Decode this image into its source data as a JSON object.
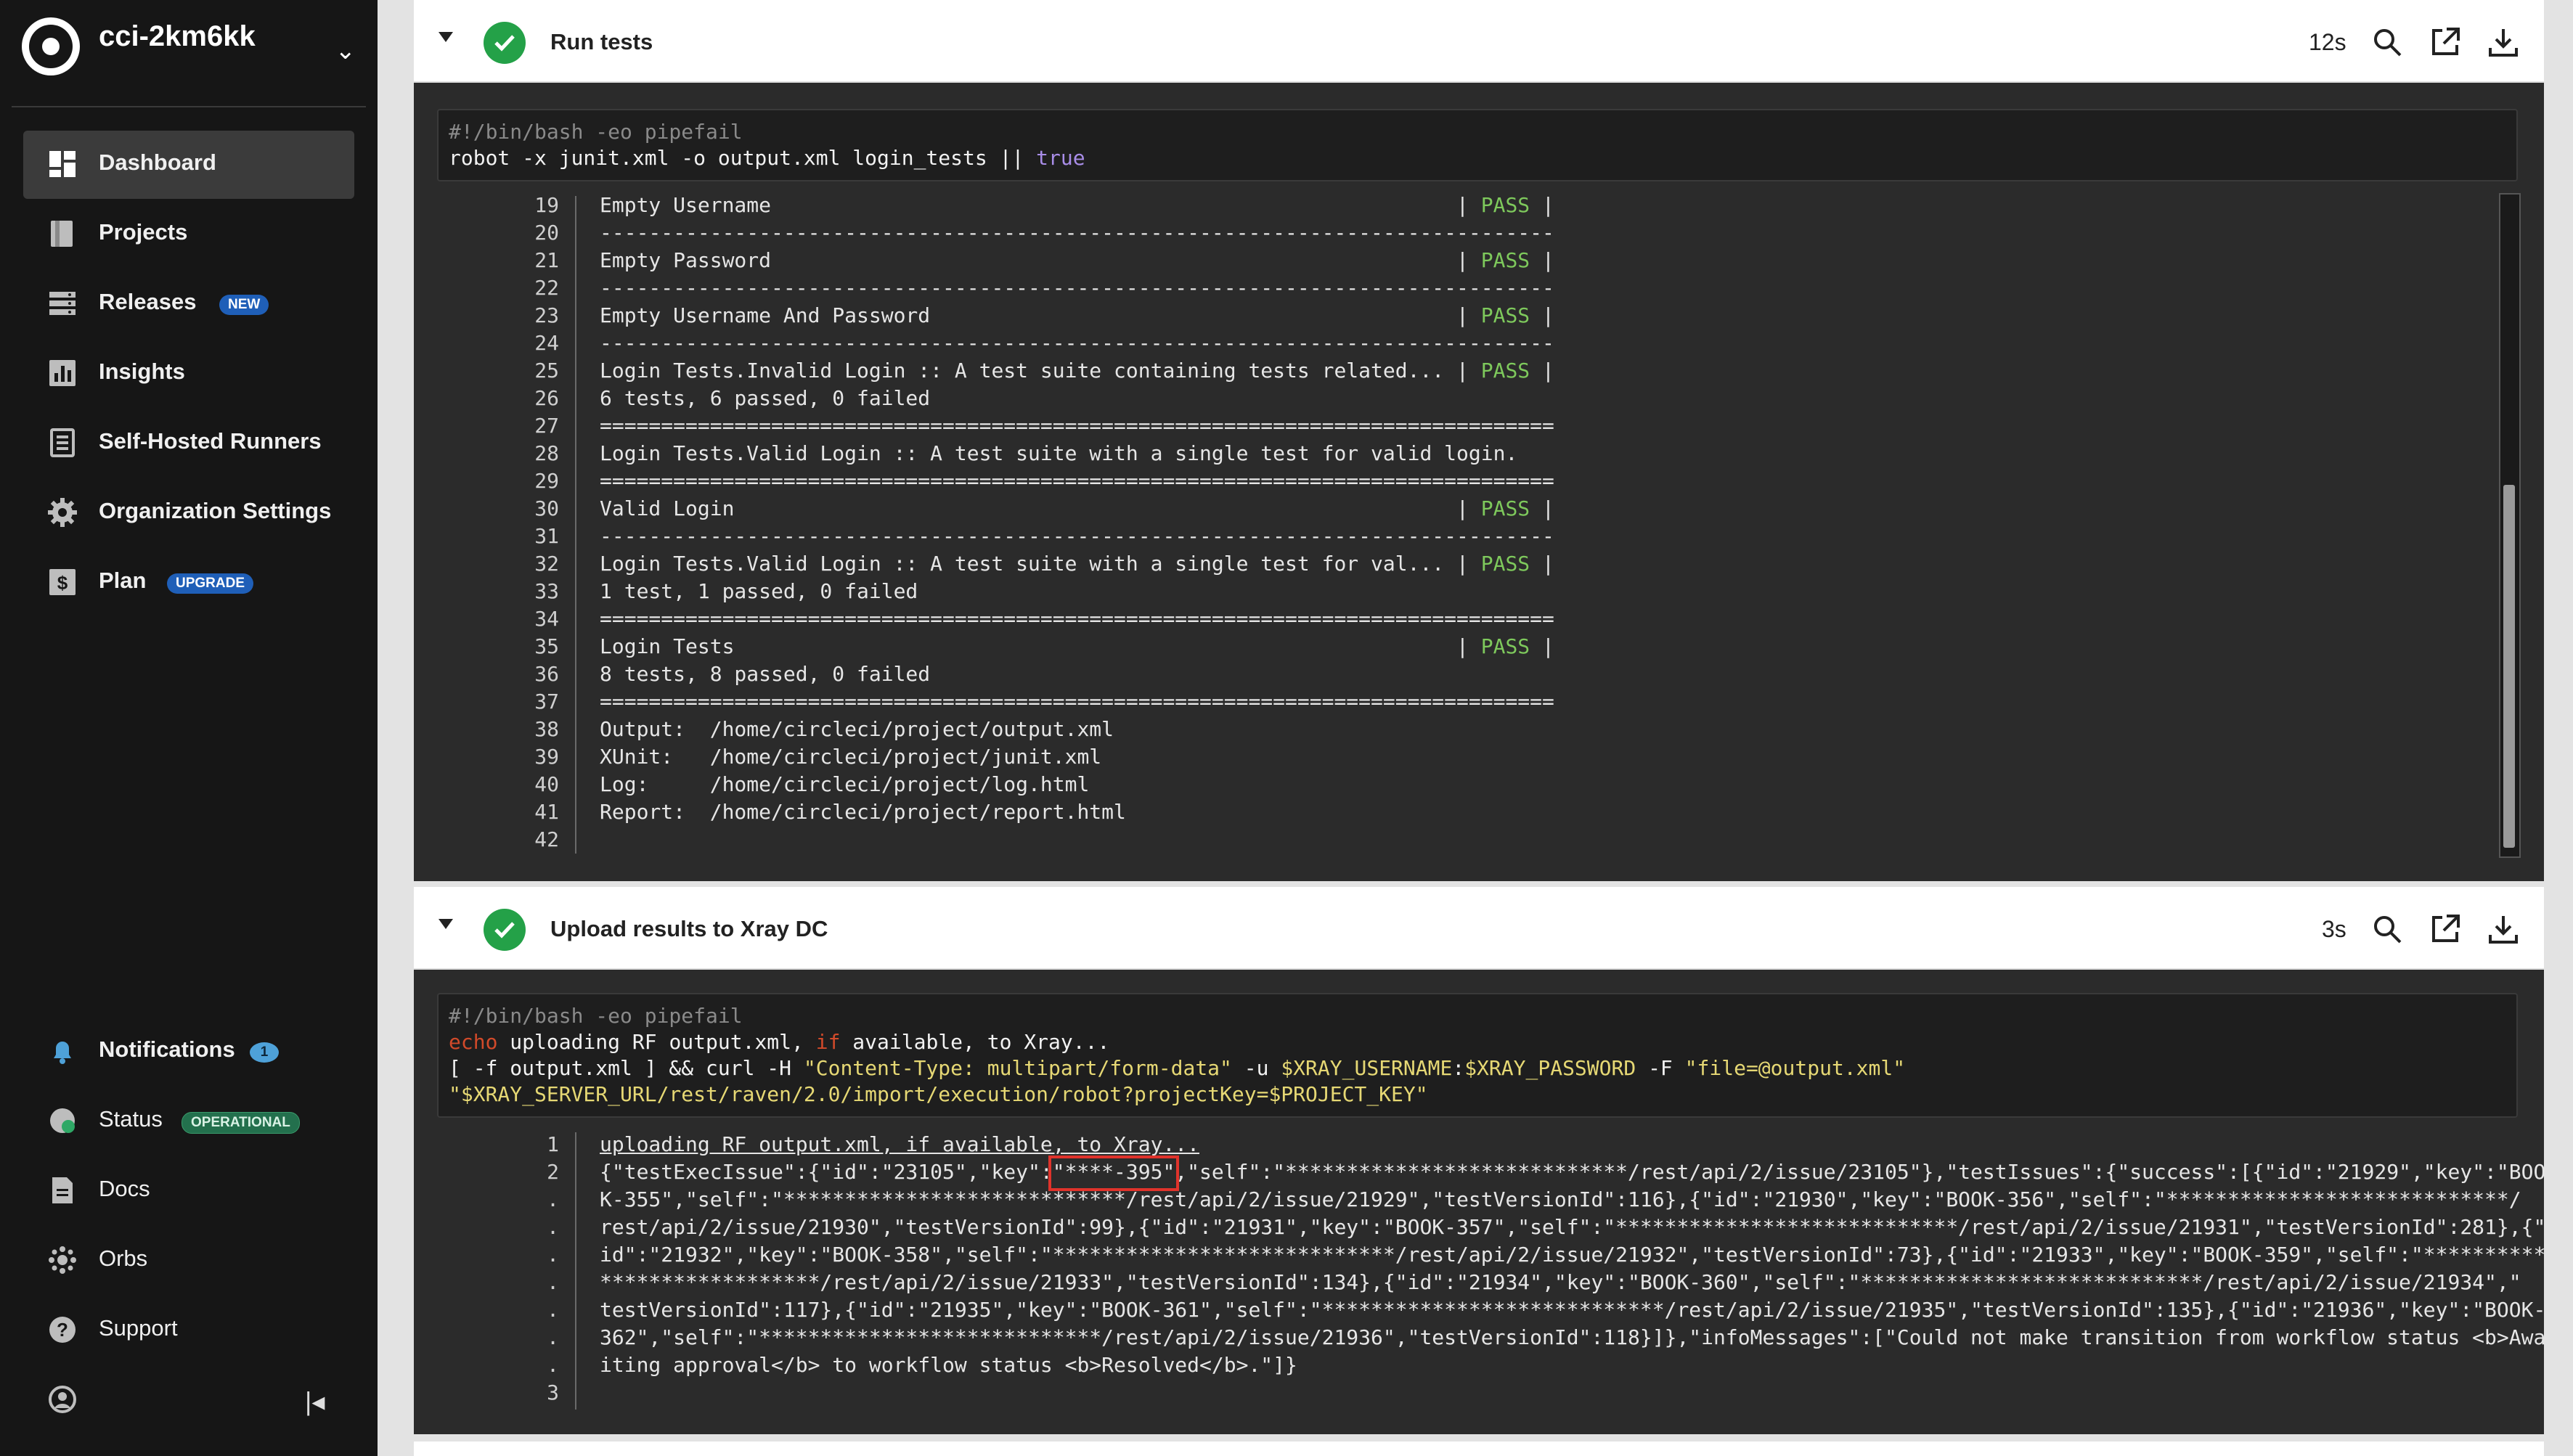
{
  "sidebar": {
    "org_name": "cci-2km6kk",
    "items": [
      {
        "label": "Dashboard",
        "icon": "dashboard-icon",
        "active": true
      },
      {
        "label": "Projects",
        "icon": "projects-icon"
      },
      {
        "label": "Releases",
        "icon": "releases-icon",
        "badge": "NEW"
      },
      {
        "label": "Insights",
        "icon": "insights-icon"
      },
      {
        "label": "Self-Hosted Runners",
        "icon": "runners-icon"
      },
      {
        "label": "Organization Settings",
        "icon": "gear-icon"
      },
      {
        "label": "Plan",
        "icon": "dollar-icon",
        "badge": "UPGRADE"
      }
    ],
    "bottom_items": [
      {
        "label": "Notifications",
        "icon": "bell-icon",
        "badge": "1"
      },
      {
        "label": "Status",
        "icon": "status-icon",
        "badge": "OPERATIONAL"
      },
      {
        "label": "Docs",
        "icon": "docs-icon"
      },
      {
        "label": "Orbs",
        "icon": "orbs-icon"
      },
      {
        "label": "Support",
        "icon": "help-icon"
      }
    ]
  },
  "steps": [
    {
      "title": "Run tests",
      "duration": "12s",
      "shebang": "#!/bin/bash -eo pipefail",
      "command": "robot -x junit.xml -o output.xml login_tests || ",
      "command_true": "true",
      "lines": [
        {
          "n": "19",
          "text": "Empty Username                                                        | ",
          "pass": "PASS",
          "end": " |"
        },
        {
          "n": "20",
          "text": "------------------------------------------------------------------------------"
        },
        {
          "n": "21",
          "text": "Empty Password                                                        | ",
          "pass": "PASS",
          "end": " |"
        },
        {
          "n": "22",
          "text": "------------------------------------------------------------------------------"
        },
        {
          "n": "23",
          "text": "Empty Username And Password                                           | ",
          "pass": "PASS",
          "end": " |"
        },
        {
          "n": "24",
          "text": "------------------------------------------------------------------------------"
        },
        {
          "n": "25",
          "text": "Login Tests.Invalid Login :: A test suite containing tests related... | ",
          "pass": "PASS",
          "end": " |"
        },
        {
          "n": "26",
          "text": "6 tests, 6 passed, 0 failed"
        },
        {
          "n": "27",
          "text": "=============================================================================="
        },
        {
          "n": "28",
          "text": "Login Tests.Valid Login :: A test suite with a single test for valid login."
        },
        {
          "n": "29",
          "text": "=============================================================================="
        },
        {
          "n": "30",
          "text": "Valid Login                                                           | ",
          "pass": "PASS",
          "end": " |"
        },
        {
          "n": "31",
          "text": "------------------------------------------------------------------------------"
        },
        {
          "n": "32",
          "text": "Login Tests.Valid Login :: A test suite with a single test for val... | ",
          "pass": "PASS",
          "end": " |"
        },
        {
          "n": "33",
          "text": "1 test, 1 passed, 0 failed"
        },
        {
          "n": "34",
          "text": "=============================================================================="
        },
        {
          "n": "35",
          "text": "Login Tests                                                           | ",
          "pass": "PASS",
          "end": " |"
        },
        {
          "n": "36",
          "text": "8 tests, 8 passed, 0 failed"
        },
        {
          "n": "37",
          "text": "=============================================================================="
        },
        {
          "n": "38",
          "text": "Output:  /home/circleci/project/output.xml"
        },
        {
          "n": "39",
          "text": "XUnit:   /home/circleci/project/junit.xml"
        },
        {
          "n": "40",
          "text": "Log:     /home/circleci/project/log.html"
        },
        {
          "n": "41",
          "text": "Report:  /home/circleci/project/report.html"
        },
        {
          "n": "42",
          "text": ""
        }
      ]
    },
    {
      "title": "Upload results to Xray DC",
      "duration": "3s",
      "shebang": "#!/bin/bash -eo pipefail",
      "cmd2_echo": "echo",
      "cmd2_a": " uploading RF output.xml, ",
      "cmd2_if": "if",
      "cmd2_b": " available, to Xray...",
      "cmd3_a": "[ -f output.xml ] && curl -H ",
      "cmd3_str1": "\"Content-Type: multipart/form-data\"",
      "cmd3_b": " -u ",
      "cmd3_var": "$XRAY_USERNAME",
      "cmd3_c": ":",
      "cmd3_var2": "$XRAY_PASSWORD",
      "cmd3_d": " -F ",
      "cmd3_str2": "\"file=@output.xml\"",
      "cmd4": "\"$XRAY_SERVER_URL/rest/raven/2.0/import/execution/robot?projectKey=$PROJECT_KEY\"",
      "line1_n": "1",
      "line1": "uploading RF output.xml, if available, to Xray...",
      "line2_n": "2",
      "line2_pre": "{\"testExecIssue\":{\"id\":\"23105\",\"key\":",
      "line2_key": "\"****-395\"",
      "line2_post": ",\"self\":\"****************************/rest/api/2/issue/23105\"},\"testIssues\":{\"success\":[{\"id\":\"21929\",\"key\":\"BOO",
      "wrap": [
        "K-355\",\"self\":\"****************************/rest/api/2/issue/21929\",\"testVersionId\":116},{\"id\":\"21930\",\"key\":\"BOOK-356\",\"self\":\"****************************/",
        "rest/api/2/issue/21930\",\"testVersionId\":99},{\"id\":\"21931\",\"key\":\"BOOK-357\",\"self\":\"****************************/rest/api/2/issue/21931\",\"testVersionId\":281},{\"",
        "id\":\"21932\",\"key\":\"BOOK-358\",\"self\":\"****************************/rest/api/2/issue/21932\",\"testVersionId\":73},{\"id\":\"21933\",\"key\":\"BOOK-359\",\"self\":\"**********",
        "******************/rest/api/2/issue/21933\",\"testVersionId\":134},{\"id\":\"21934\",\"key\":\"BOOK-360\",\"self\":\"****************************/rest/api/2/issue/21934\",\"",
        "testVersionId\":117},{\"id\":\"21935\",\"key\":\"BOOK-361\",\"self\":\"****************************/rest/api/2/issue/21935\",\"testVersionId\":135},{\"id\":\"21936\",\"key\":\"BOOK-",
        "362\",\"self\":\"****************************/rest/api/2/issue/21936\",\"testVersionId\":118}]},\"infoMessages\":[\"Could not make transition from workflow status <b>Awa",
        "iting approval</b> to workflow status <b>Resolved</b>.\"]}"
      ],
      "dot": ".",
      "line3_n": "3"
    }
  ],
  "colors": {
    "pass": "#7ec95c",
    "success": "#24a148",
    "highlight": "#e0332b"
  }
}
